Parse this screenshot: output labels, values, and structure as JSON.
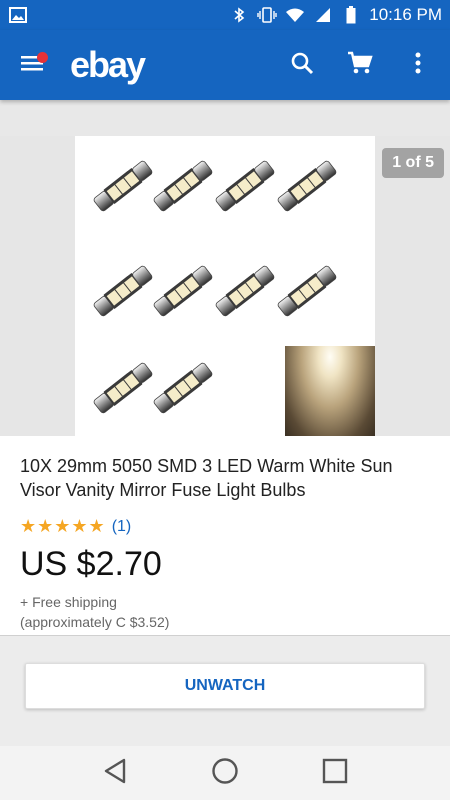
{
  "status_bar": {
    "time": "10:16 PM",
    "icons": [
      "image-icon",
      "bluetooth-icon",
      "vibrate-icon",
      "wifi-icon",
      "signal-icon",
      "battery-icon"
    ]
  },
  "app_bar": {
    "logo": "ebay",
    "icons": [
      "menu-icon",
      "search-icon",
      "cart-icon",
      "more-vert-icon"
    ],
    "brand_color": "#1565c0"
  },
  "gallery": {
    "page_indicator": "1 of 5"
  },
  "listing": {
    "title": "10X 29mm 5050 SMD 3 LED Warm White Sun Visor Vanity Mirror Fuse Light Bulbs",
    "stars": "★★★★★",
    "review_count": "(1)",
    "price": "US $2.70",
    "shipping": "+ Free shipping",
    "approx_price": "(approximately C $3.52)"
  },
  "actions": {
    "unwatch_label": "UNWATCH"
  },
  "nav_bar": {
    "icons": [
      "back-icon",
      "home-icon",
      "recents-icon"
    ]
  }
}
